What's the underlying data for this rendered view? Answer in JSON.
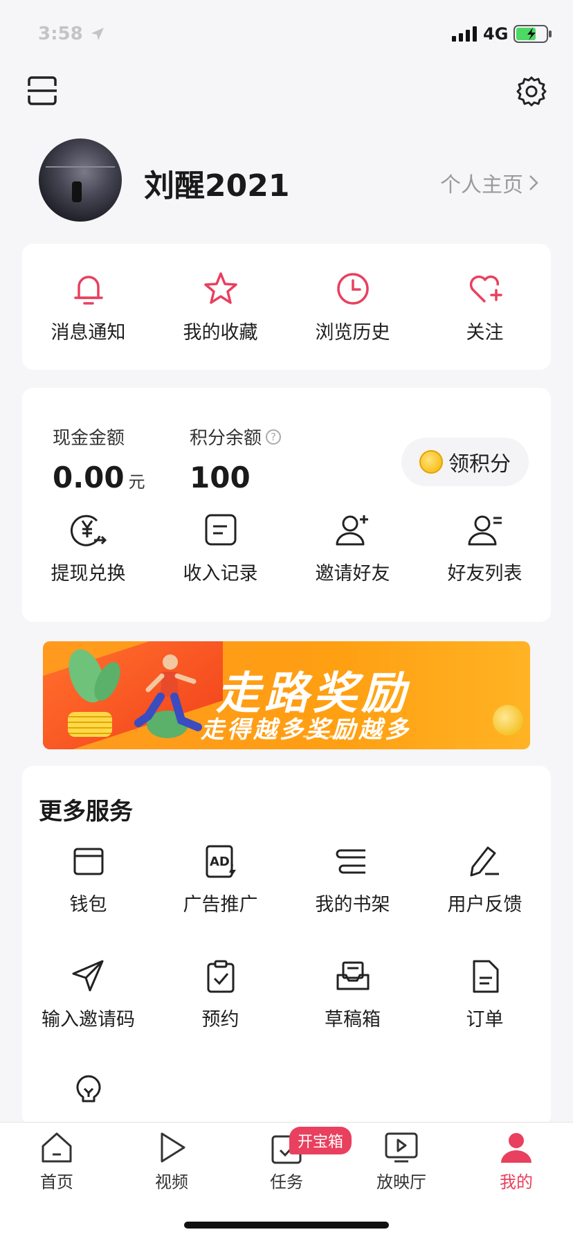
{
  "status_bar": {
    "time": "3:58",
    "network": "4G"
  },
  "profile": {
    "username": "刘醒2021",
    "home_link": "个人主页"
  },
  "quick_actions": [
    {
      "label": "消息通知",
      "icon": "bell-icon"
    },
    {
      "label": "我的收藏",
      "icon": "star-icon"
    },
    {
      "label": "浏览历史",
      "icon": "clock-icon"
    },
    {
      "label": "关注",
      "icon": "heart-plus-icon"
    }
  ],
  "wallet": {
    "cash_title": "现金金额",
    "cash_value": "0.00",
    "cash_unit": "元",
    "points_title": "积分余额",
    "points_value": "100",
    "claim_label": "领积分",
    "actions": [
      {
        "label": "提现兑换",
        "icon": "yuan-exchange-icon"
      },
      {
        "label": "收入记录",
        "icon": "record-icon"
      },
      {
        "label": "邀请好友",
        "icon": "invite-user-icon"
      },
      {
        "label": "好友列表",
        "icon": "friend-list-icon"
      }
    ]
  },
  "banner": {
    "title": "走路奖励",
    "subtitle": "走得越多奖励越多"
  },
  "more_services": {
    "title": "更多服务",
    "items": [
      {
        "label": "钱包",
        "icon": "wallet-icon"
      },
      {
        "label": "广告推广",
        "icon": "ad-icon"
      },
      {
        "label": "我的书架",
        "icon": "bookshelf-icon"
      },
      {
        "label": "用户反馈",
        "icon": "feedback-icon"
      },
      {
        "label": "输入邀请码",
        "icon": "paper-plane-icon"
      },
      {
        "label": "预约",
        "icon": "clipboard-check-icon"
      },
      {
        "label": "草稿箱",
        "icon": "drafts-icon"
      },
      {
        "label": "订单",
        "icon": "order-icon"
      },
      {
        "label": "",
        "icon": "lightbulb-icon"
      }
    ]
  },
  "tabbar": {
    "tabs": [
      {
        "label": "首页",
        "icon": "home-icon"
      },
      {
        "label": "视频",
        "icon": "play-icon"
      },
      {
        "label": "任务",
        "icon": "task-icon"
      },
      {
        "label": "放映厅",
        "icon": "theater-icon"
      },
      {
        "label": "我的",
        "icon": "profile-icon"
      }
    ],
    "active": "我的",
    "task_badge": "开宝箱"
  },
  "colors": {
    "accent": "#e8405e",
    "banner": "#ff9f12"
  }
}
